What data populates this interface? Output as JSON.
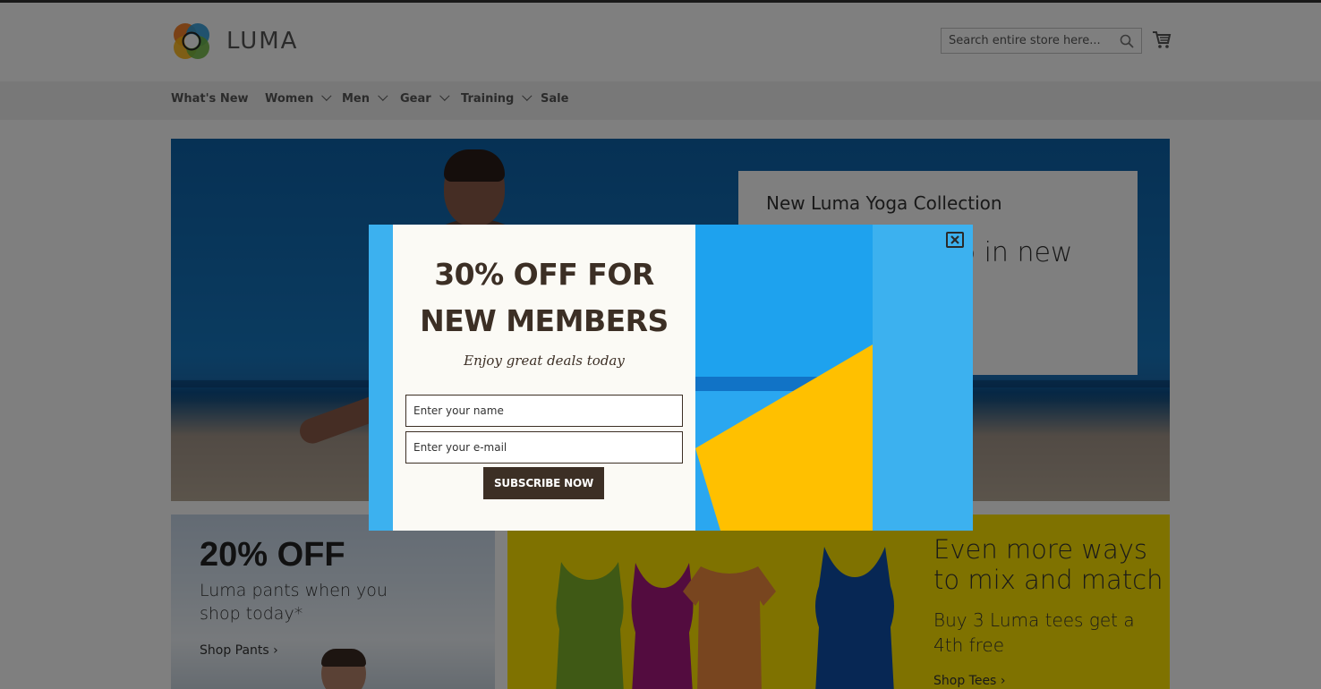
{
  "header": {
    "logo_text": "LUMA",
    "search_placeholder": "Search entire store here..."
  },
  "nav": {
    "items": [
      {
        "label": "What's New",
        "has_dropdown": false
      },
      {
        "label": "Women",
        "has_dropdown": true
      },
      {
        "label": "Men",
        "has_dropdown": true
      },
      {
        "label": "Gear",
        "has_dropdown": true
      },
      {
        "label": "Training",
        "has_dropdown": true
      },
      {
        "label": "Sale",
        "has_dropdown": false
      }
    ]
  },
  "hero": {
    "card_title": "New Luma Yoga Collection",
    "card_heading_partial": "b in new"
  },
  "promos": {
    "pants": {
      "headline": "20% OFF",
      "text": "Luma pants when you shop today*",
      "link": "Shop Pants"
    },
    "tees": {
      "headline": "Even more ways to mix and match",
      "text": "Buy 3 Luma tees get a 4th free",
      "link": "Shop Tees"
    }
  },
  "popup": {
    "heading_line1": "30% OFF FOR",
    "heading_line2": "NEW MEMBERS",
    "subheading": "Enjoy great deals today",
    "name_placeholder": "Enter your name",
    "email_placeholder": "Enter your e-mail",
    "button_label": "SUBSCRIBE NOW",
    "close_icon": "close-icon"
  },
  "colors": {
    "popup_brown": "#3c2f25",
    "popup_blue": "#3cb1ef",
    "popup_yellow": "#ffc000",
    "promo_yellow": "#ffe500"
  }
}
